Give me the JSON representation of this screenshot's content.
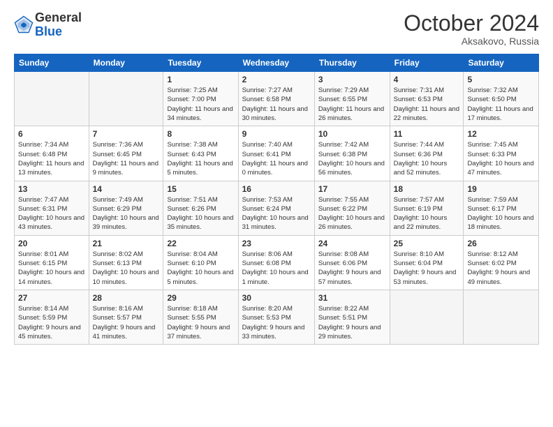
{
  "logo": {
    "general": "General",
    "blue": "Blue"
  },
  "title": "October 2024",
  "location": "Aksakovo, Russia",
  "days_of_week": [
    "Sunday",
    "Monday",
    "Tuesday",
    "Wednesday",
    "Thursday",
    "Friday",
    "Saturday"
  ],
  "weeks": [
    [
      {
        "day": "",
        "info": ""
      },
      {
        "day": "",
        "info": ""
      },
      {
        "day": "1",
        "info": "Sunrise: 7:25 AM\nSunset: 7:00 PM\nDaylight: 11 hours and 34 minutes."
      },
      {
        "day": "2",
        "info": "Sunrise: 7:27 AM\nSunset: 6:58 PM\nDaylight: 11 hours and 30 minutes."
      },
      {
        "day": "3",
        "info": "Sunrise: 7:29 AM\nSunset: 6:55 PM\nDaylight: 11 hours and 26 minutes."
      },
      {
        "day": "4",
        "info": "Sunrise: 7:31 AM\nSunset: 6:53 PM\nDaylight: 11 hours and 22 minutes."
      },
      {
        "day": "5",
        "info": "Sunrise: 7:32 AM\nSunset: 6:50 PM\nDaylight: 11 hours and 17 minutes."
      }
    ],
    [
      {
        "day": "6",
        "info": "Sunrise: 7:34 AM\nSunset: 6:48 PM\nDaylight: 11 hours and 13 minutes."
      },
      {
        "day": "7",
        "info": "Sunrise: 7:36 AM\nSunset: 6:45 PM\nDaylight: 11 hours and 9 minutes."
      },
      {
        "day": "8",
        "info": "Sunrise: 7:38 AM\nSunset: 6:43 PM\nDaylight: 11 hours and 5 minutes."
      },
      {
        "day": "9",
        "info": "Sunrise: 7:40 AM\nSunset: 6:41 PM\nDaylight: 11 hours and 0 minutes."
      },
      {
        "day": "10",
        "info": "Sunrise: 7:42 AM\nSunset: 6:38 PM\nDaylight: 10 hours and 56 minutes."
      },
      {
        "day": "11",
        "info": "Sunrise: 7:44 AM\nSunset: 6:36 PM\nDaylight: 10 hours and 52 minutes."
      },
      {
        "day": "12",
        "info": "Sunrise: 7:45 AM\nSunset: 6:33 PM\nDaylight: 10 hours and 47 minutes."
      }
    ],
    [
      {
        "day": "13",
        "info": "Sunrise: 7:47 AM\nSunset: 6:31 PM\nDaylight: 10 hours and 43 minutes."
      },
      {
        "day": "14",
        "info": "Sunrise: 7:49 AM\nSunset: 6:29 PM\nDaylight: 10 hours and 39 minutes."
      },
      {
        "day": "15",
        "info": "Sunrise: 7:51 AM\nSunset: 6:26 PM\nDaylight: 10 hours and 35 minutes."
      },
      {
        "day": "16",
        "info": "Sunrise: 7:53 AM\nSunset: 6:24 PM\nDaylight: 10 hours and 31 minutes."
      },
      {
        "day": "17",
        "info": "Sunrise: 7:55 AM\nSunset: 6:22 PM\nDaylight: 10 hours and 26 minutes."
      },
      {
        "day": "18",
        "info": "Sunrise: 7:57 AM\nSunset: 6:19 PM\nDaylight: 10 hours and 22 minutes."
      },
      {
        "day": "19",
        "info": "Sunrise: 7:59 AM\nSunset: 6:17 PM\nDaylight: 10 hours and 18 minutes."
      }
    ],
    [
      {
        "day": "20",
        "info": "Sunrise: 8:01 AM\nSunset: 6:15 PM\nDaylight: 10 hours and 14 minutes."
      },
      {
        "day": "21",
        "info": "Sunrise: 8:02 AM\nSunset: 6:13 PM\nDaylight: 10 hours and 10 minutes."
      },
      {
        "day": "22",
        "info": "Sunrise: 8:04 AM\nSunset: 6:10 PM\nDaylight: 10 hours and 5 minutes."
      },
      {
        "day": "23",
        "info": "Sunrise: 8:06 AM\nSunset: 6:08 PM\nDaylight: 10 hours and 1 minute."
      },
      {
        "day": "24",
        "info": "Sunrise: 8:08 AM\nSunset: 6:06 PM\nDaylight: 9 hours and 57 minutes."
      },
      {
        "day": "25",
        "info": "Sunrise: 8:10 AM\nSunset: 6:04 PM\nDaylight: 9 hours and 53 minutes."
      },
      {
        "day": "26",
        "info": "Sunrise: 8:12 AM\nSunset: 6:02 PM\nDaylight: 9 hours and 49 minutes."
      }
    ],
    [
      {
        "day": "27",
        "info": "Sunrise: 8:14 AM\nSunset: 5:59 PM\nDaylight: 9 hours and 45 minutes."
      },
      {
        "day": "28",
        "info": "Sunrise: 8:16 AM\nSunset: 5:57 PM\nDaylight: 9 hours and 41 minutes."
      },
      {
        "day": "29",
        "info": "Sunrise: 8:18 AM\nSunset: 5:55 PM\nDaylight: 9 hours and 37 minutes."
      },
      {
        "day": "30",
        "info": "Sunrise: 8:20 AM\nSunset: 5:53 PM\nDaylight: 9 hours and 33 minutes."
      },
      {
        "day": "31",
        "info": "Sunrise: 8:22 AM\nSunset: 5:51 PM\nDaylight: 9 hours and 29 minutes."
      },
      {
        "day": "",
        "info": ""
      },
      {
        "day": "",
        "info": ""
      }
    ]
  ]
}
